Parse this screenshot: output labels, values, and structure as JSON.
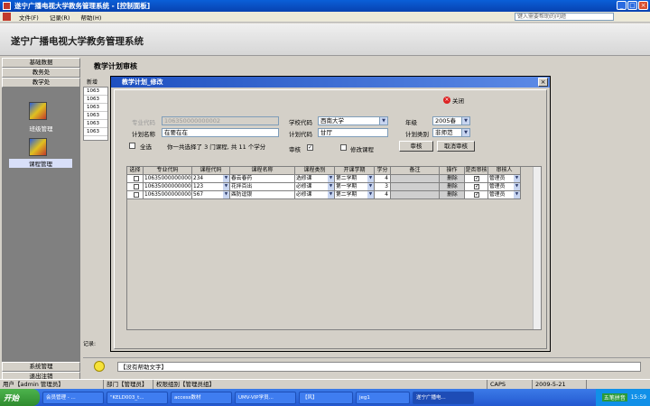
{
  "window": {
    "title": "遂宁广播电视大学教务管理系统 - [控制面板]"
  },
  "menu": {
    "items": [
      "文件(F)",
      "记录(R)",
      "帮助(H)"
    ],
    "help_placeholder": "键入需要帮助的问题"
  },
  "banner": {
    "title": "遂宁广播电视大学教务管理系统"
  },
  "leftnav": {
    "top_items": [
      "基础数据",
      "教务处",
      "教学处"
    ],
    "modules": [
      {
        "label": "班级管理",
        "icon": "class-management-icon"
      },
      {
        "label": "课程管理",
        "icon": "course-management-icon"
      }
    ],
    "bottom_items": [
      "系统管理",
      "退出注销"
    ]
  },
  "main": {
    "title": "教学计划审核",
    "toolbar_label": "新增",
    "bg_rows": [
      "1063",
      "1063",
      "1063",
      "1063",
      "1063",
      "1063"
    ],
    "record_label": "记录:"
  },
  "helpbar": {
    "text": "【没有帮助文字】"
  },
  "status": {
    "user": "用户【admin 管理员】",
    "dept": "部门【管理员】",
    "role": "权限组别【管理员组】",
    "caps": "CAPS",
    "date": "2009-5-21"
  },
  "taskbar": {
    "start": "开始",
    "tasks": [
      "会员管理 - ...",
      "\"KELD003_t...",
      "access数材",
      "UMV-VIP学员...",
      "【风】",
      "jeg1",
      "遂宁广播电..."
    ],
    "ime": "五笔拼音",
    "time": "15:59"
  },
  "dialog": {
    "title": "教学计划_修改",
    "close_label": "关闭",
    "fields": {
      "major_code_label": "专业代码",
      "major_code_value": "106350000000002",
      "plan_name_label": "计划名称",
      "plan_name_value": "在要在在",
      "school_code_label": "学校代码",
      "school_code_value": "西南大学",
      "plan_code_label": "计划代码",
      "plan_code_value": "甘厅",
      "grade_label": "年级",
      "grade_value": "2005春",
      "plan_type_label": "计划类别",
      "plan_type_value": "非师范"
    },
    "select_all_label": "全选",
    "summary_text": "你一共选择了 3 门课程, 共 11 个学分",
    "audit_label": "审核",
    "modify_course_label": "修改课程",
    "audit_button": "审核",
    "cancel_audit_button": "取消审核",
    "grid": {
      "headers": [
        "选择",
        "专业代码",
        "课程代码",
        "课程名称",
        "课程类别",
        "开课学期",
        "学分",
        "备注",
        "操作",
        "是否审核",
        "审核人"
      ],
      "rows": [
        {
          "major": "106350000000002",
          "course_code": "234",
          "course_name": "春云春药",
          "type": "选修课",
          "term": "第二学期",
          "credit": "4",
          "note": "",
          "op": "删除",
          "reviewer": "管理员"
        },
        {
          "major": "106350000000002",
          "course_code": "123",
          "course_name": "花拌百出",
          "type": "必修课",
          "term": "第一学期",
          "credit": "3",
          "note": "",
          "op": "删除",
          "reviewer": "管理员"
        },
        {
          "major": "106350000000002",
          "course_code": "567",
          "course_name": "酉防逗银",
          "type": "必修课",
          "term": "第二学期",
          "credit": "4",
          "note": "",
          "op": "删除",
          "reviewer": "管理员"
        }
      ]
    }
  }
}
